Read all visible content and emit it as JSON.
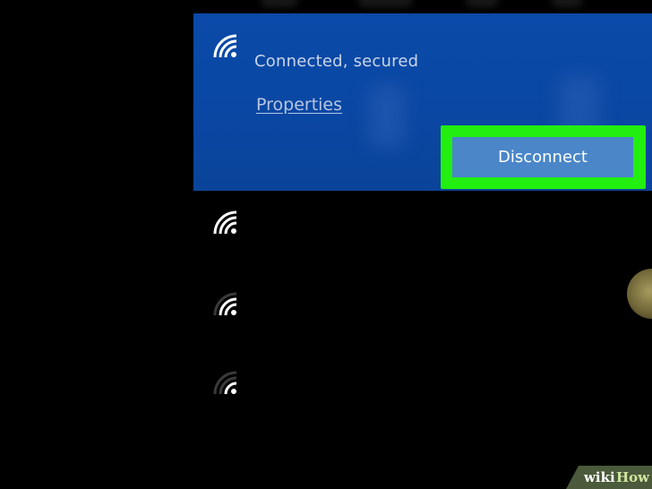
{
  "connected_network": {
    "status": "Connected, secured",
    "properties_link": "Properties",
    "disconnect_button": "Disconnect",
    "icon": "wifi-icon"
  },
  "other_networks": [
    {
      "icon": "wifi-icon",
      "signal": "strong"
    },
    {
      "icon": "wifi-icon",
      "signal": "medium"
    },
    {
      "icon": "wifi-icon",
      "signal": "weak"
    }
  ],
  "watermark": {
    "part1": "wiki",
    "part2": "How"
  },
  "colors": {
    "panel": "#0b4aa8",
    "button": "#4a86c8",
    "highlight": "#22ee10",
    "background": "#000000"
  }
}
